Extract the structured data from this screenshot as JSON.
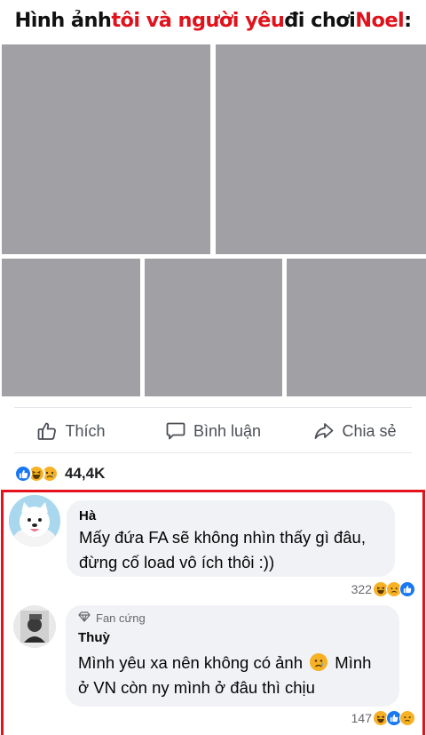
{
  "headline": {
    "part1": "Hình ảnh ",
    "part2": "tôi và người yêu",
    "part3": " đi chơi ",
    "part4": "Noel",
    "part5": ":",
    "accent_color": "#e0121b"
  },
  "photos": [
    {
      "icon": "photo-placeholder",
      "color": "#a1a1a5"
    },
    {
      "icon": "photo-placeholder",
      "color": "#a1a1a5"
    },
    {
      "icon": "photo-placeholder",
      "color": "#a1a1a5"
    },
    {
      "icon": "photo-placeholder",
      "color": "#a1a1a5"
    },
    {
      "icon": "photo-placeholder",
      "color": "#a1a1a5"
    }
  ],
  "actions": {
    "like_label": "Thích",
    "comment_label": "Bình luận",
    "share_label": "Chia sẻ"
  },
  "post_reactions": {
    "icons": [
      "like-icon",
      "haha-icon",
      "sad-icon"
    ],
    "count": "44,4K"
  },
  "comments": [
    {
      "author": "Hà",
      "line1": "Mấy đứa FA sẽ không nhìn thấy gì đâu,",
      "line2": "đừng cố load vô ích thôi :))",
      "reaction_count": "322",
      "reaction_icons": [
        "haha-icon",
        "sad-icon",
        "like-icon"
      ]
    },
    {
      "badge": "Fan cứng",
      "author": "Thuỳ",
      "line1a": "Mình yêu xa nên không có ảnh",
      "line1b": "Mình",
      "line2": "ở VN còn ny mình ở đâu thì chịu",
      "reaction_count": "147",
      "reaction_icons": [
        "haha-icon",
        "like-icon",
        "sad-icon"
      ]
    }
  ],
  "colors": {
    "highlight_border": "#e3121d",
    "like_blue": "#1877f2",
    "emoji_yellow": "#f7b125",
    "bubble_bg": "#f0f2f5"
  }
}
